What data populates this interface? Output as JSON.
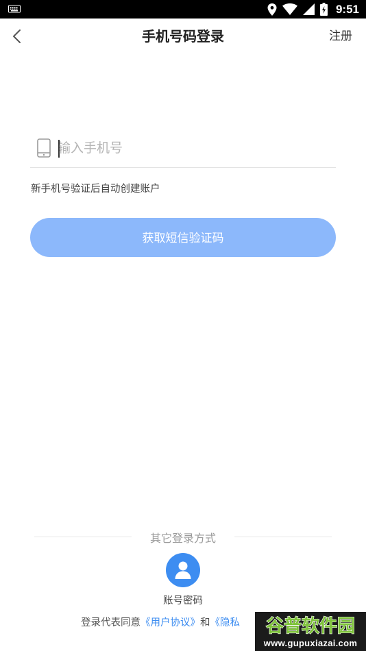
{
  "status_bar": {
    "time": "9:51",
    "icons": [
      "keyboard-icon",
      "location-icon",
      "wifi-icon",
      "signal-icon",
      "battery-icon"
    ]
  },
  "header": {
    "title": "手机号码登录",
    "register_label": "注册",
    "back_icon": "back-arrow-icon"
  },
  "login_form": {
    "phone_icon": "phone-icon",
    "phone_placeholder": "输入手机号",
    "phone_value": "",
    "hint": "新手机号验证后自动创建账户",
    "get_code_label": "获取短信验证码",
    "button_color": "#8cb8fb"
  },
  "other_login": {
    "title": "其它登录方式",
    "account_label": "账号密码",
    "account_icon": "user-icon",
    "accent_color": "#3d8df1"
  },
  "agreement": {
    "prefix": "登录代表同意",
    "user_agreement": "《用户协议》",
    "and": "和",
    "privacy_partial": "《隐私"
  },
  "watermark": {
    "brand": "谷普软件园",
    "url": "www.gupuxiazai.com"
  }
}
